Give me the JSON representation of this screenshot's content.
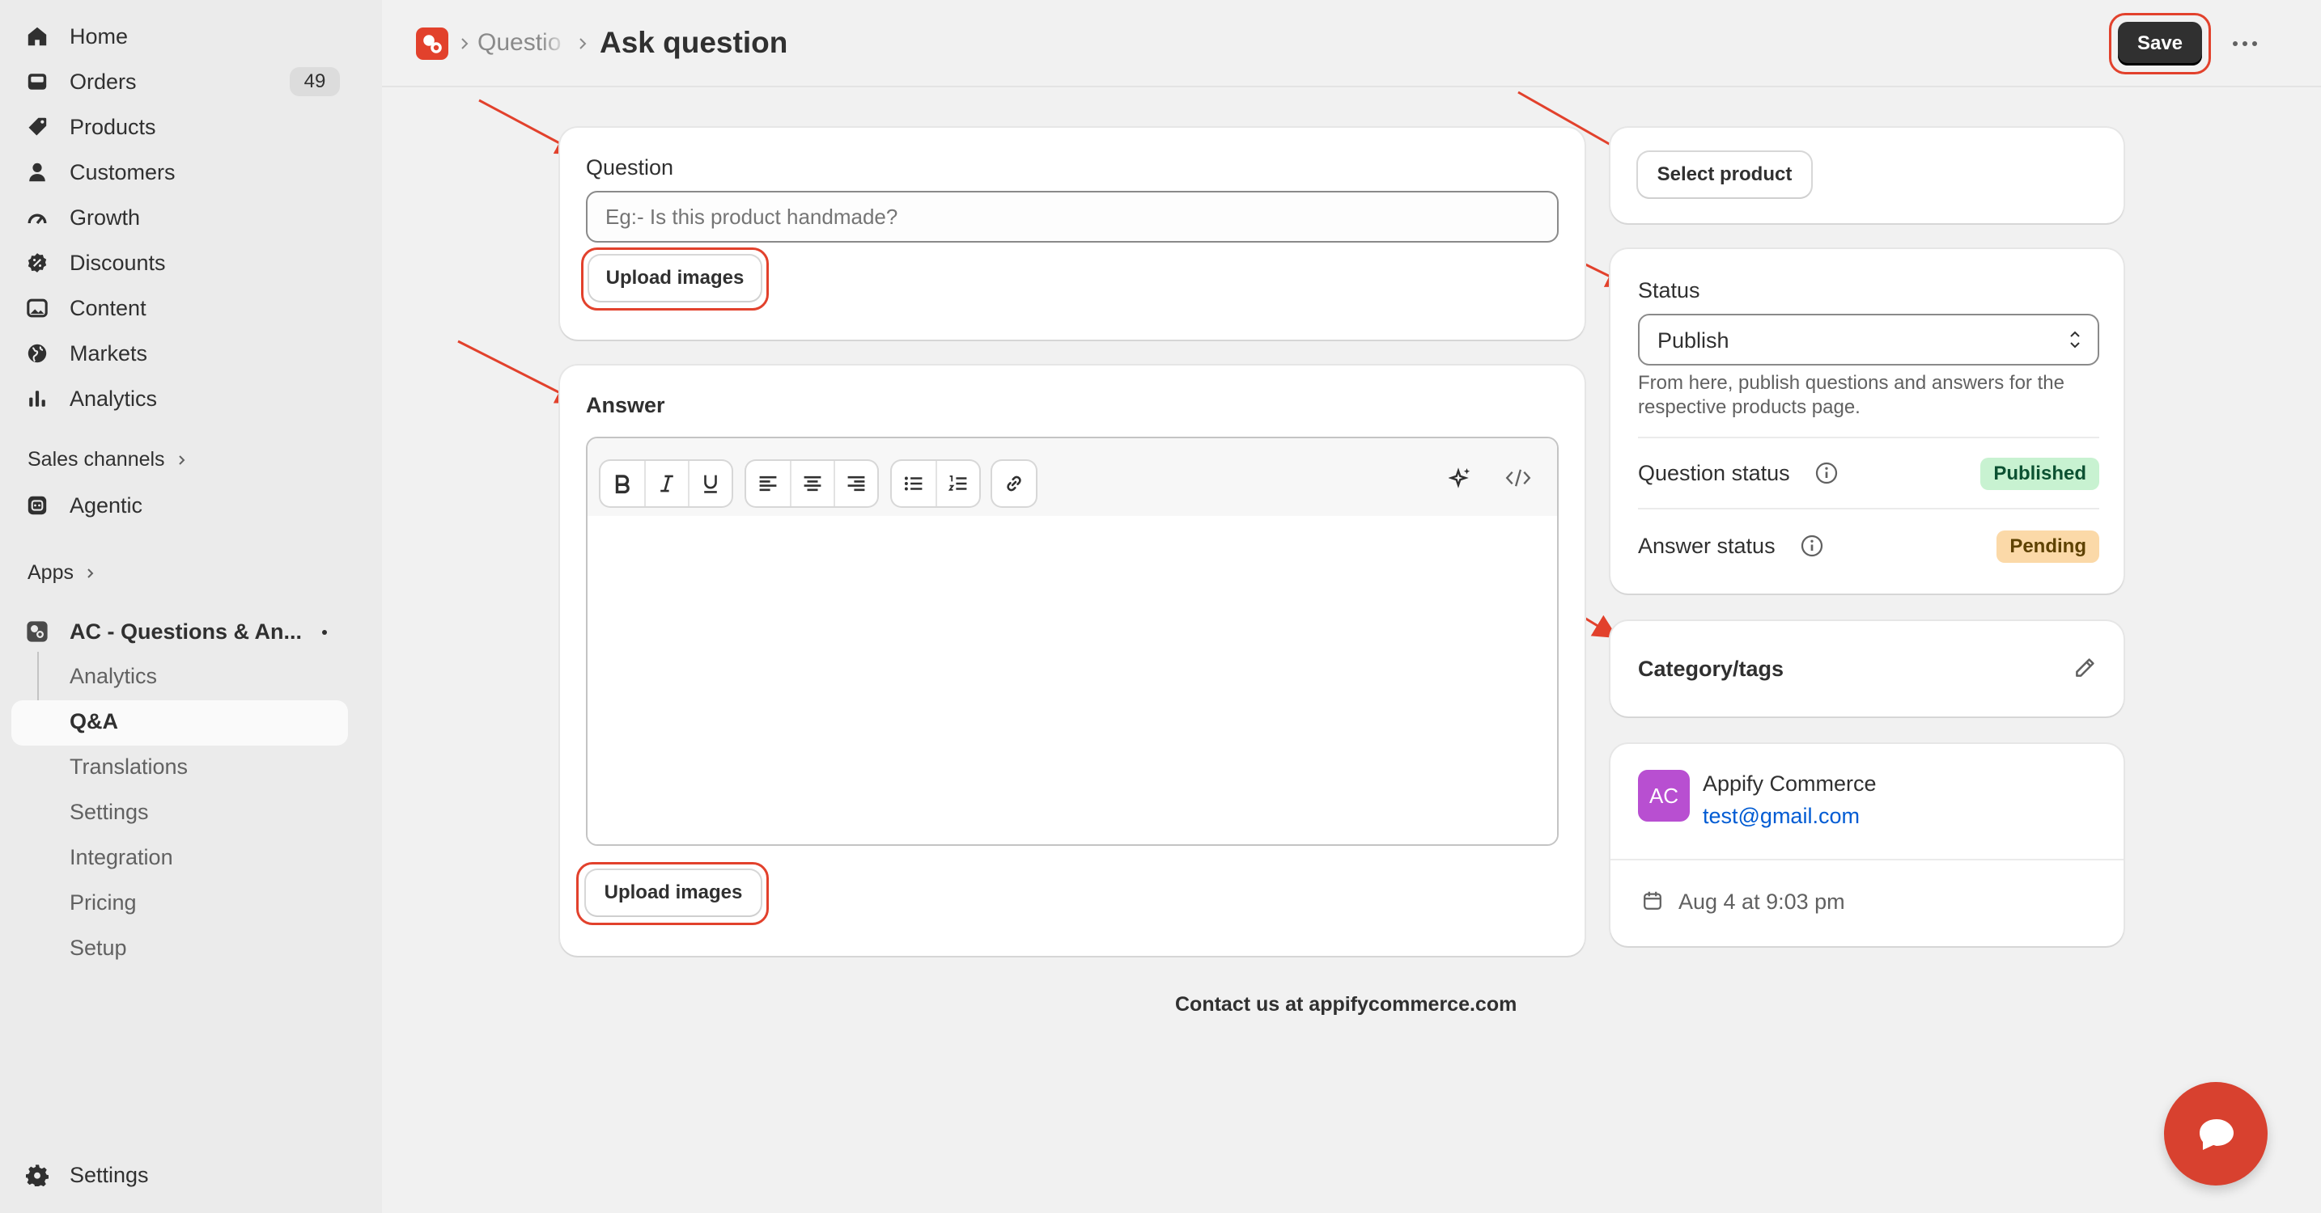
{
  "sidebar": {
    "items": [
      {
        "label": "Home",
        "icon": "home-icon"
      },
      {
        "label": "Orders",
        "icon": "orders-icon",
        "badge": "49"
      },
      {
        "label": "Products",
        "icon": "tag-icon"
      },
      {
        "label": "Customers",
        "icon": "person-icon"
      },
      {
        "label": "Growth",
        "icon": "gauge-icon"
      },
      {
        "label": "Discounts",
        "icon": "discount-icon"
      },
      {
        "label": "Content",
        "icon": "image-icon"
      },
      {
        "label": "Markets",
        "icon": "globe-icon"
      },
      {
        "label": "Analytics",
        "icon": "bar-chart-icon"
      }
    ],
    "sales_channels_label": "Sales channels",
    "agentic_label": "Agentic",
    "apps_label": "Apps",
    "app_name": "AC - Questions & An...",
    "app_subitems": [
      "Analytics",
      "Q&A",
      "Translations",
      "Settings",
      "Integration",
      "Pricing",
      "Setup"
    ],
    "settings_label": "Settings"
  },
  "header": {
    "breadcrumb_parent": "Questio",
    "title": "Ask question",
    "save_label": "Save"
  },
  "question_card": {
    "label": "Question",
    "placeholder": "Eg:- Is this product handmade?",
    "upload_label": "Upload images"
  },
  "answer_card": {
    "label": "Answer",
    "upload_label": "Upload images"
  },
  "product_card": {
    "select_label": "Select product"
  },
  "status_card": {
    "label": "Status",
    "selected": "Publish",
    "help_line1": "From here, publish questions and answers for the",
    "help_line2": "respective products page.",
    "question_status_label": "Question status",
    "question_status": "Published",
    "answer_status_label": "Answer status",
    "answer_status": "Pending"
  },
  "category_card": {
    "label": "Category/tags"
  },
  "customer_card": {
    "initials": "AC",
    "name": "Appify Commerce",
    "email": "test@gmail.com",
    "date": "Aug 4 at 9:03 pm"
  },
  "footer": {
    "contact": "Contact us at appifycommerce.com"
  },
  "colors": {
    "accent_red": "#e2412c",
    "published_bg": "#c8f2d1",
    "pending_bg": "#fbd9a8",
    "avatar_bg": "#b84fd1",
    "link_blue": "#005bd3"
  }
}
